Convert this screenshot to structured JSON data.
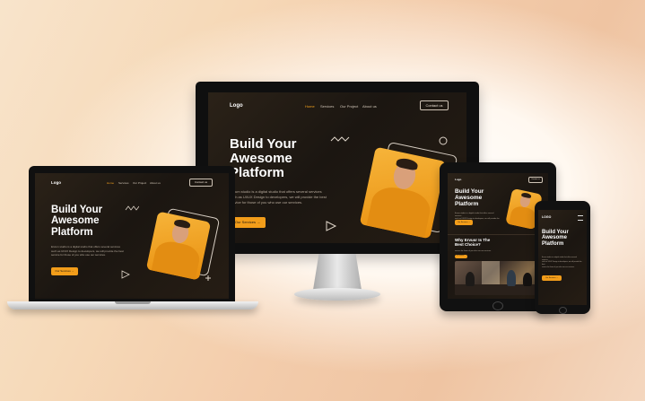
{
  "site": {
    "logo": "Logo",
    "logo_caps": "LOGO",
    "nav": [
      "Home",
      "Services",
      "Our Project",
      "About us"
    ],
    "contact": "Contact us",
    "hero_line1": "Build Your",
    "hero_line2": "Awesome",
    "hero_line3": "Platform",
    "desc_line1": "Ervum studio is a digital studio that offers several services",
    "desc_line2": "such as UI/UX Design to developers, we will provide the best",
    "desc_line3": "service for those of you who use our services.",
    "desc_short_line1": "Ervum studio is a digital studio that offers several services",
    "desc_short_line2": "such as UI/UX Design to developers, we will provide the best",
    "desc_short_line3": "service for those of you who use our services.",
    "cta": "Our Services →",
    "why_line1": "Why Ervusr Is The",
    "why_line2": "Best Choice?"
  },
  "colors": {
    "accent": "#f29d1a",
    "screen_bg": "#1b1611",
    "device_frame": "#111111",
    "silver": "#c9c9c9"
  }
}
